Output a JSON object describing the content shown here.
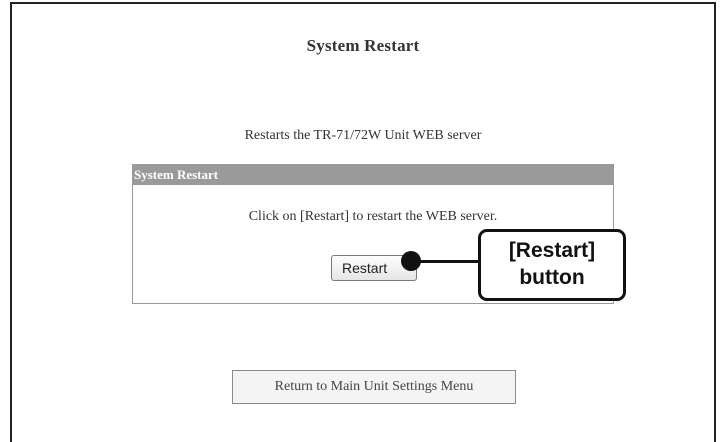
{
  "page": {
    "title": "System Restart",
    "subtitle": "Restarts the TR-71/72W Unit WEB server"
  },
  "panel": {
    "header": "System Restart",
    "message": "Click on [Restart] to restart the WEB server.",
    "restart_label": "Restart"
  },
  "footer": {
    "return_label": "Return to Main Unit Settings Menu"
  },
  "callout": {
    "line1": "[Restart]",
    "line2": "button"
  }
}
